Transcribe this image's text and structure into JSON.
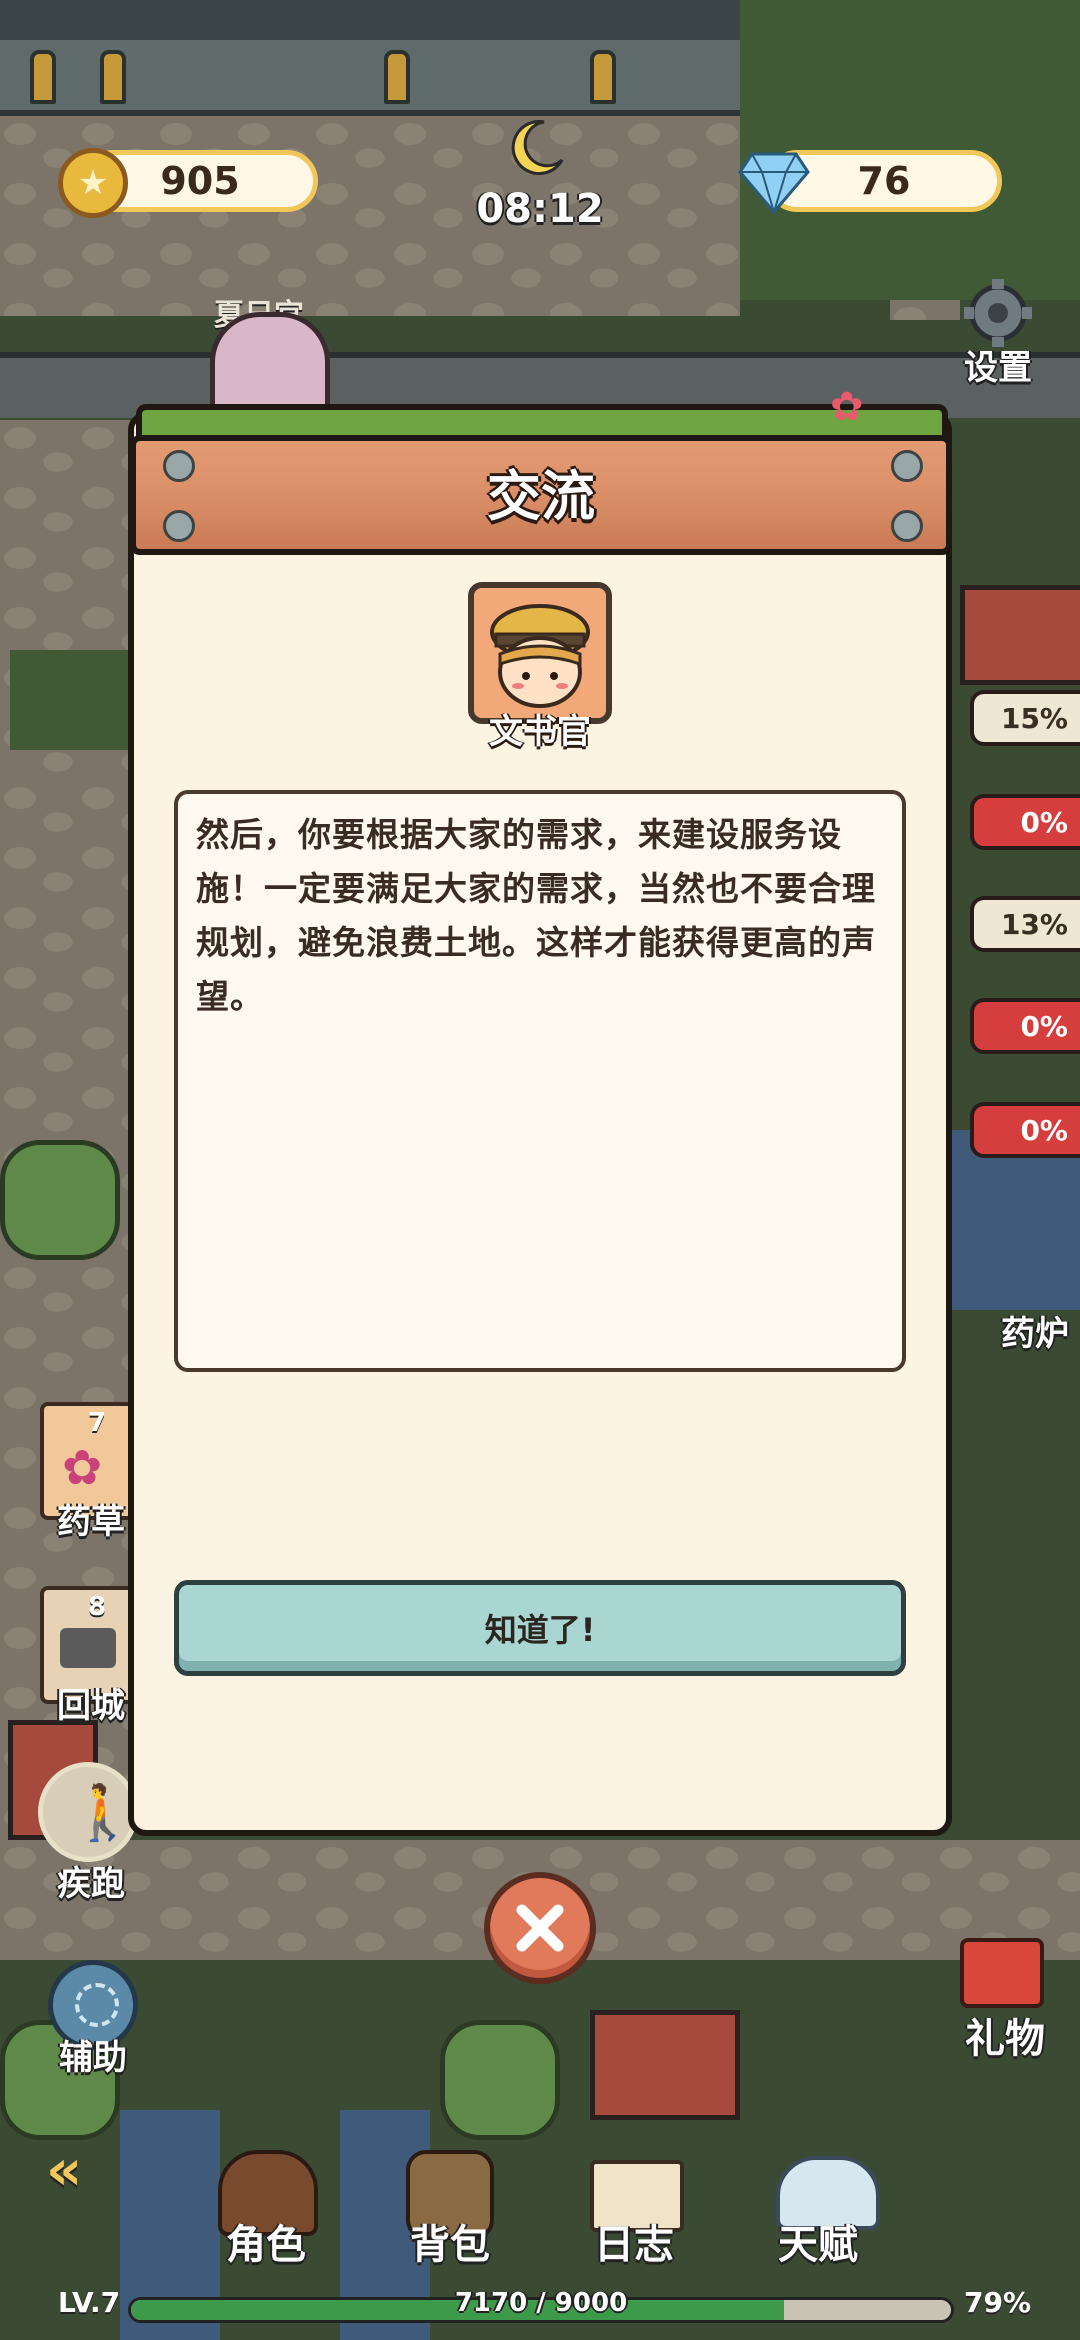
{
  "hud": {
    "coins": "905",
    "time": "08:12",
    "gems": "76",
    "settings_label": "设置",
    "sign_label": "夏日宫"
  },
  "side_left": {
    "herb_count": "7",
    "herb_label": "药草",
    "return_count": "8",
    "return_label": "回城",
    "sprint_label": "疾跑",
    "assist_label": "辅助"
  },
  "side_right": {
    "stats": [
      "15%",
      "0%",
      "13%",
      "0%",
      "0%"
    ],
    "furnace_label": "药炉",
    "gift_label": "礼物"
  },
  "dialog": {
    "title": "交流",
    "npc_name": "文书官",
    "message": "然后，你要根据大家的需求，来建设服务设施！一定要满足大家的需求，当然也不要合理规划，避免浪费土地。这样才能获得更高的声望。",
    "confirm_label": "知道了!"
  },
  "bottom": {
    "nav": [
      "角色",
      "背包",
      "日志",
      "天赋"
    ],
    "level": "LV.7",
    "xp_text": "7170 / 9000",
    "xp_percent": "79%",
    "xp_fraction": 0.7967
  }
}
